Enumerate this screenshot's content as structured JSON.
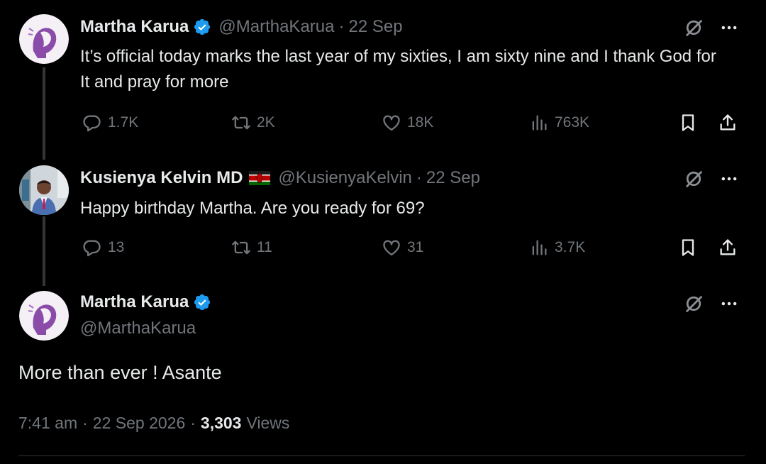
{
  "colors": {
    "bg": "#000000",
    "text": "#e7e9ea",
    "muted": "#71767b",
    "verified": "#1d9bf0"
  },
  "tweets": [
    {
      "name": "Martha Karua",
      "handle": "@MarthaKarua",
      "sep": "·",
      "date": "22 Sep",
      "text": "It’s official today marks the last year of my sixties, I am sixty nine and I thank God for It and pray for more",
      "replies": "1.7K",
      "retweets": "2K",
      "likes": "18K",
      "views": "763K"
    },
    {
      "name": "Kusienya Kelvin MD",
      "handle": "@KusienyaKelvin",
      "sep": "·",
      "date": "22 Sep",
      "text": "Happy birthday Martha. Are you ready for 69?",
      "replies": "13",
      "retweets": "11",
      "likes": "31",
      "views": "3.7K"
    }
  ],
  "main": {
    "name": "Martha Karua",
    "handle": "@MarthaKarua",
    "text": "More than ever ! Asante",
    "time": "7:41 am",
    "sep1": "·",
    "date": "22 Sep 2026",
    "sep2": "·",
    "views_count": "3,303",
    "views_label": "Views"
  },
  "icons": [
    "verified-icon",
    "kenya-flag-icon",
    "grok-icon",
    "more-icon",
    "reply-icon",
    "retweet-icon",
    "like-icon",
    "views-icon",
    "bookmark-icon",
    "share-icon"
  ]
}
